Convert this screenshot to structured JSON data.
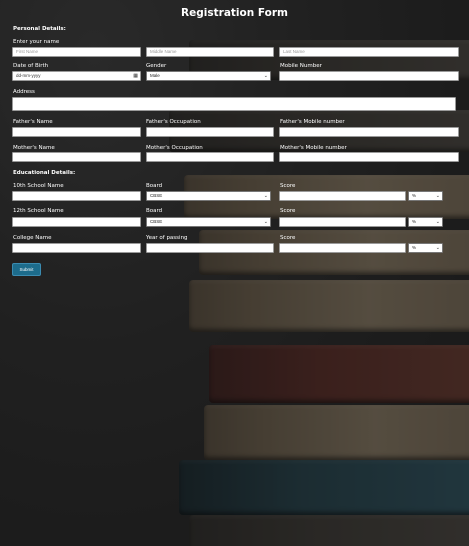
{
  "title": "Registration Form",
  "sections": {
    "personal": "Personal Details:",
    "educational": "Educational Details:"
  },
  "labels": {
    "name": "Enter your name",
    "dob": "Date of Birth",
    "gender": "Gender",
    "mobile": "Mobile Number",
    "address": "Address",
    "father_name": "Father's Name",
    "father_occupation": "Father's Occupation",
    "father_mobile": "Father's Mobile number",
    "mother_name": "Mother's Name",
    "mother_occupation": "Mother's Occupation",
    "mother_mobile": "Mother's Mobile number",
    "school10": "10th School Name",
    "school12": "12th School Name",
    "college": "College Name",
    "board": "Board",
    "score": "Score",
    "year_passing": "Year of passing"
  },
  "placeholders": {
    "first_name": "First Name",
    "middle_name": "Middle Name",
    "last_name": "Last Name"
  },
  "values": {
    "dob": "dd-mm-yyyy",
    "gender": "Male",
    "board10": "CBSE",
    "board12": "CBSE",
    "score_unit10": "%",
    "score_unit12": "%",
    "score_unit_college": "%"
  },
  "submit": "Submit",
  "icons": {
    "calendar": "calendar-icon",
    "dropdown": "chevron-down-icon"
  },
  "colors": {
    "submit_bg": "#1d6c8c",
    "background": "#2a2a2a"
  }
}
